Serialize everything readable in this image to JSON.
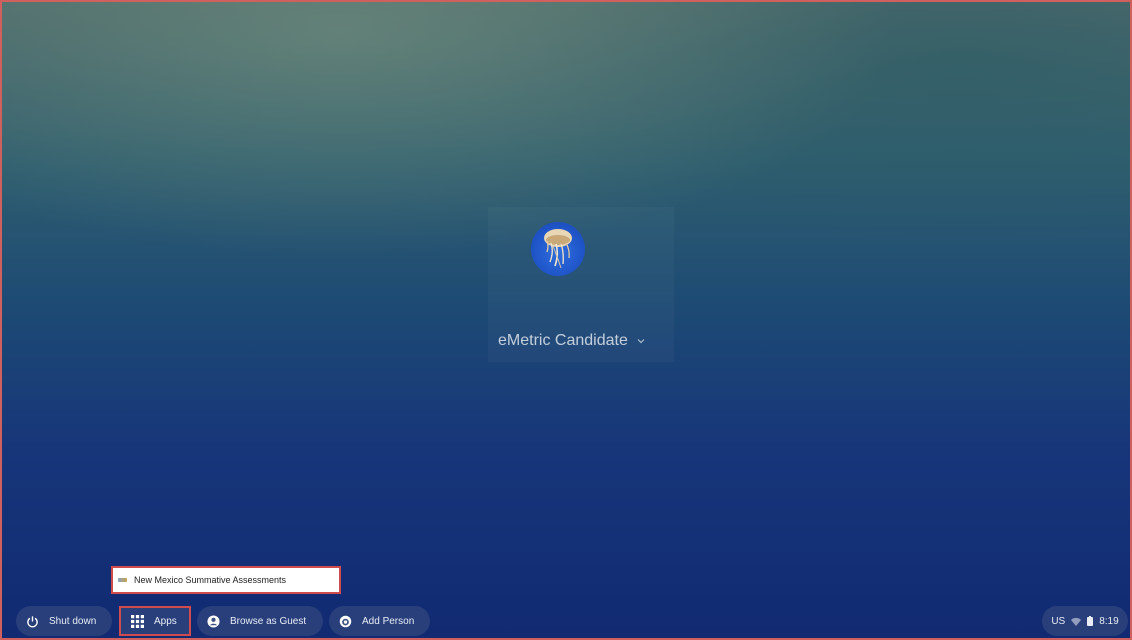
{
  "user": {
    "name": "eMetric Candidate",
    "avatar_icon": "jellyfish-avatar"
  },
  "app_menu": {
    "items": [
      {
        "label": "New Mexico Summative Assessments"
      }
    ]
  },
  "shelf": {
    "shutdown_label": "Shut down",
    "apps_label": "Apps",
    "guest_label": "Browse as Guest",
    "add_person_label": "Add Person"
  },
  "status_tray": {
    "keyboard_layout": "US",
    "time": "8:19"
  },
  "colors": {
    "highlight_border": "#d04b4b",
    "shelf_button_bg": "#3c5082",
    "wallpaper_top": "#4d6a6b",
    "wallpaper_bottom": "#112a72"
  }
}
